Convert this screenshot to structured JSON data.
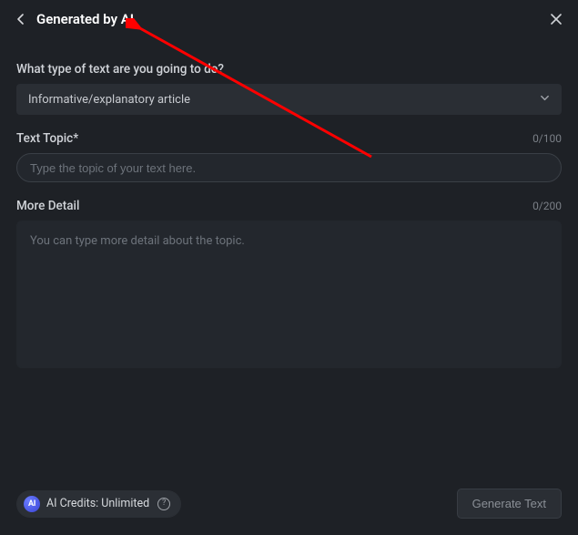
{
  "header": {
    "title": "Generated by AI"
  },
  "form": {
    "type_label": "What type of text are you going to do?",
    "type_selected": "Informative/explanatory article",
    "topic_label": "Text Topic*",
    "topic_counter": "0/100",
    "topic_placeholder": "Type the topic of your text here.",
    "detail_label": "More Detail",
    "detail_counter": "0/200",
    "detail_placeholder": "You can type more detail about the topic."
  },
  "footer": {
    "ai_badge": "AI",
    "credits_text": "AI Credits: Unlimited",
    "info_glyph": "?",
    "generate_label": "Generate Text"
  },
  "annotation": {
    "arrow_color": "#ff0000"
  }
}
